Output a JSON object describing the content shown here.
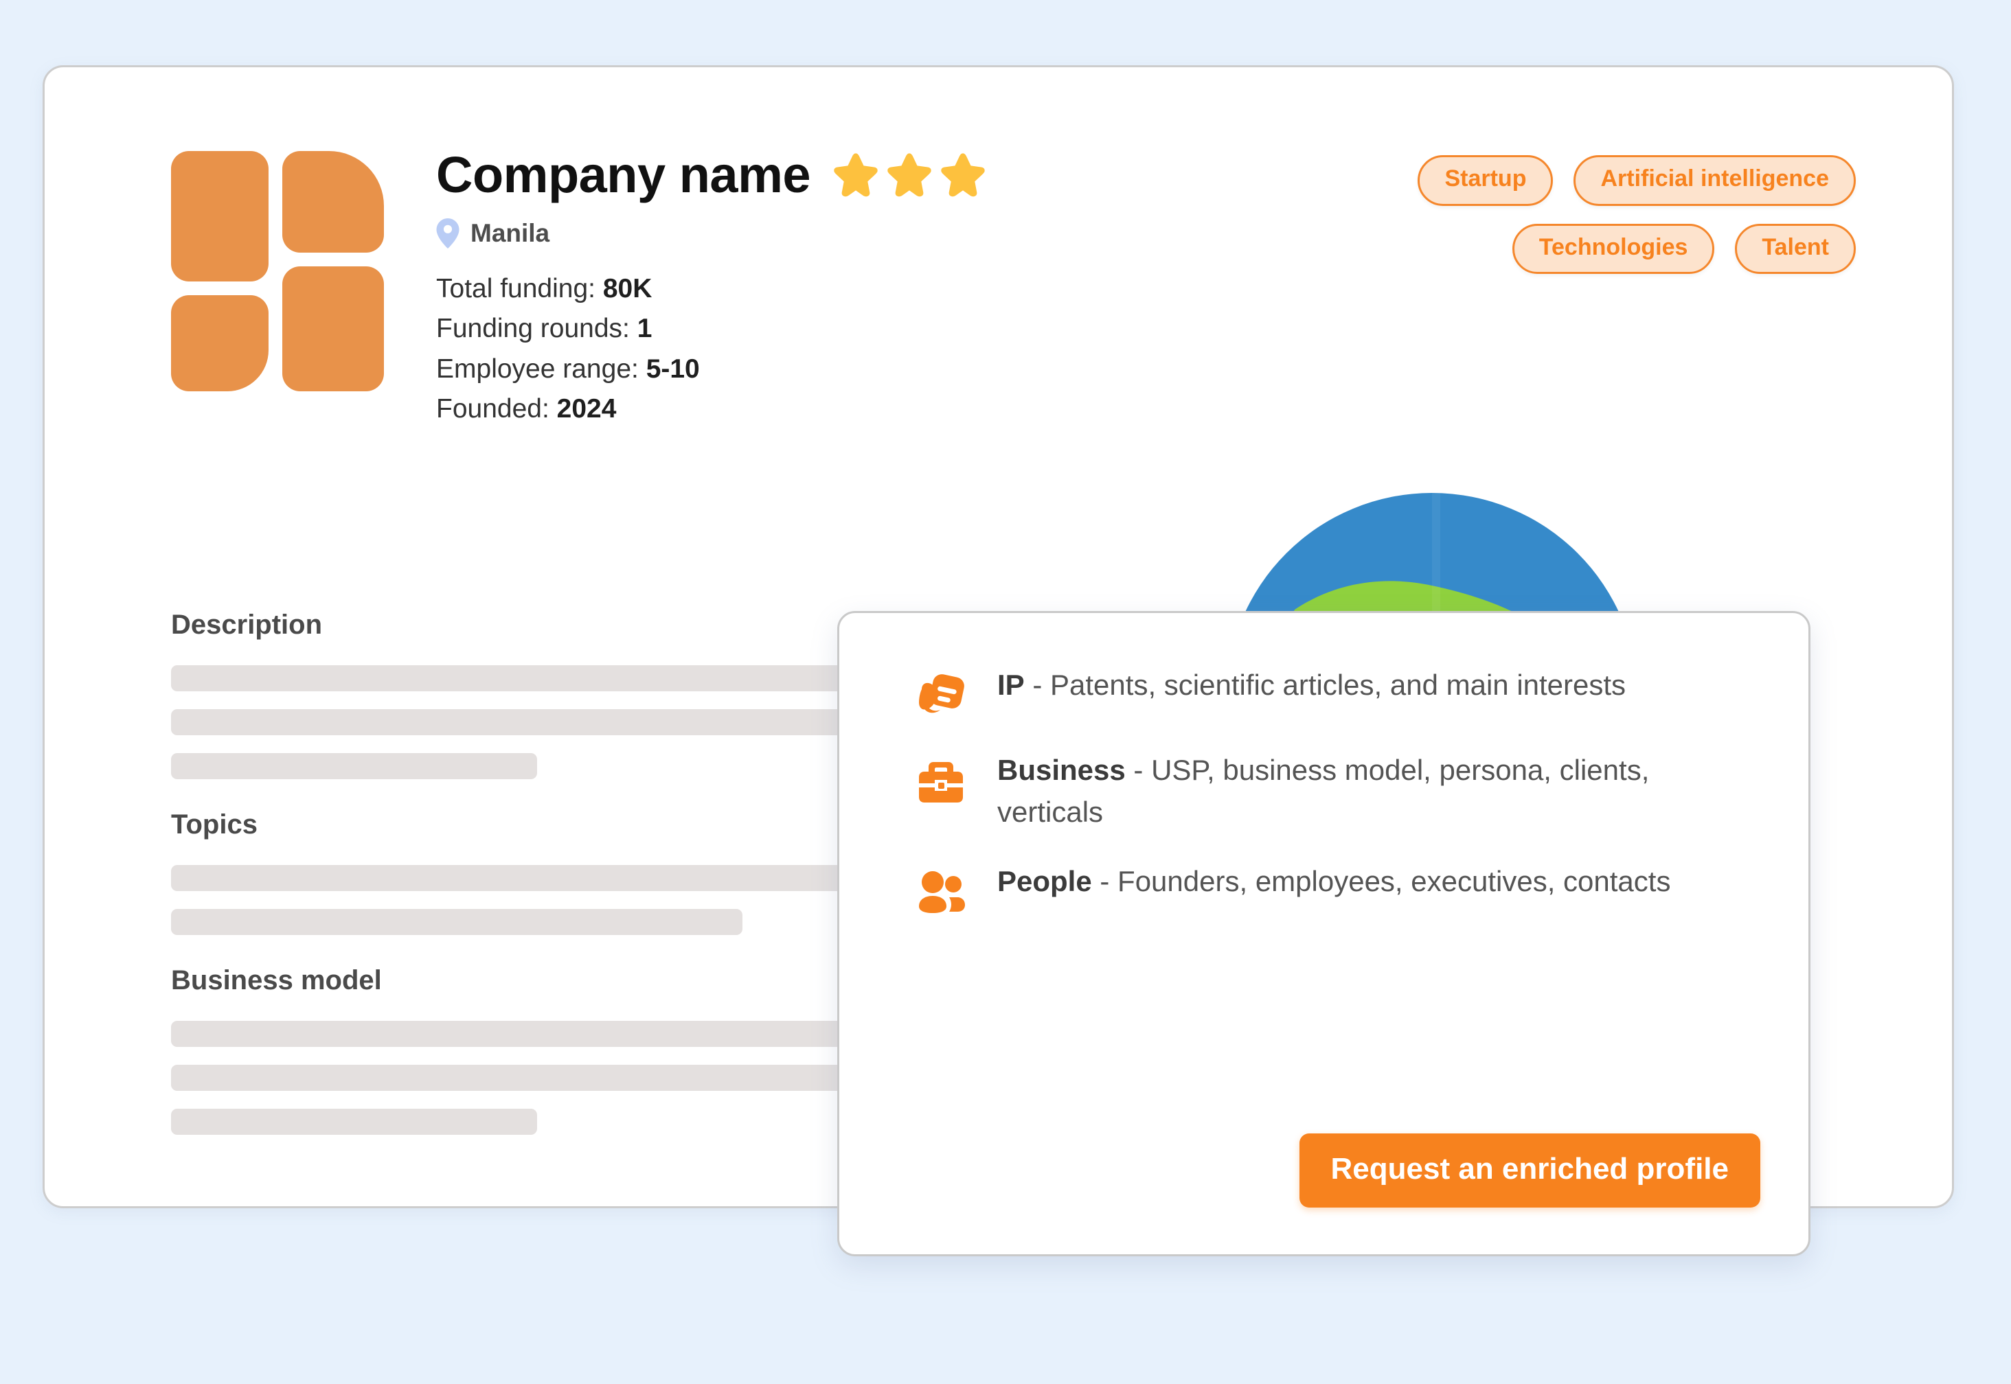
{
  "company": {
    "name": "Company name",
    "rating_stars": 3,
    "location": "Manila",
    "location_icon": "map-pin-icon",
    "stats": [
      {
        "label": "Total funding:",
        "value": "80K"
      },
      {
        "label": "Funding rounds:",
        "value": "1"
      },
      {
        "label": "Employee range:",
        "value": "5-10"
      },
      {
        "label": "Founded:",
        "value": "2024"
      }
    ],
    "tags": [
      "Startup",
      "Artificial intelligence",
      "Technologies",
      "Talent"
    ]
  },
  "sections": [
    {
      "heading": "Description",
      "bar_widths": [
        "100%",
        "100%",
        "41%"
      ]
    },
    {
      "heading": "Topics",
      "bar_widths": [
        "100%",
        "64%"
      ]
    },
    {
      "heading": "Business model",
      "bar_widths": [
        "100%",
        "100%",
        "41%"
      ]
    }
  ],
  "popup": {
    "items": [
      {
        "icon": "document-scroll-icon",
        "title": "IP",
        "separator": " - ",
        "description": "Patents, scientific articles, and main interests"
      },
      {
        "icon": "briefcase-icon",
        "title": "Business",
        "separator": " - ",
        "description": "USP, business model, persona, clients, verticals"
      },
      {
        "icon": "people-icon",
        "title": "People",
        "separator": " - ",
        "description": "Founders, employees, executives, contacts"
      }
    ],
    "cta_label": "Request an enriched profile"
  },
  "graphics": {
    "globe_icon": "earth-globe-icon",
    "logo_icon": "company-logo-tiles-icon"
  },
  "colors": {
    "page_background": "#e7f1fc",
    "accent_orange": "#f7821e",
    "logo_orange": "#e8924a",
    "tag_fill": "#fde3cd",
    "tag_border": "#f5872c",
    "star_gold": "#fdc13e",
    "pin_blue": "#b9ccf5",
    "skeleton_grey": "#e4e0df",
    "globe_ocean": "#2e86c8",
    "globe_land": "#8bd037"
  }
}
